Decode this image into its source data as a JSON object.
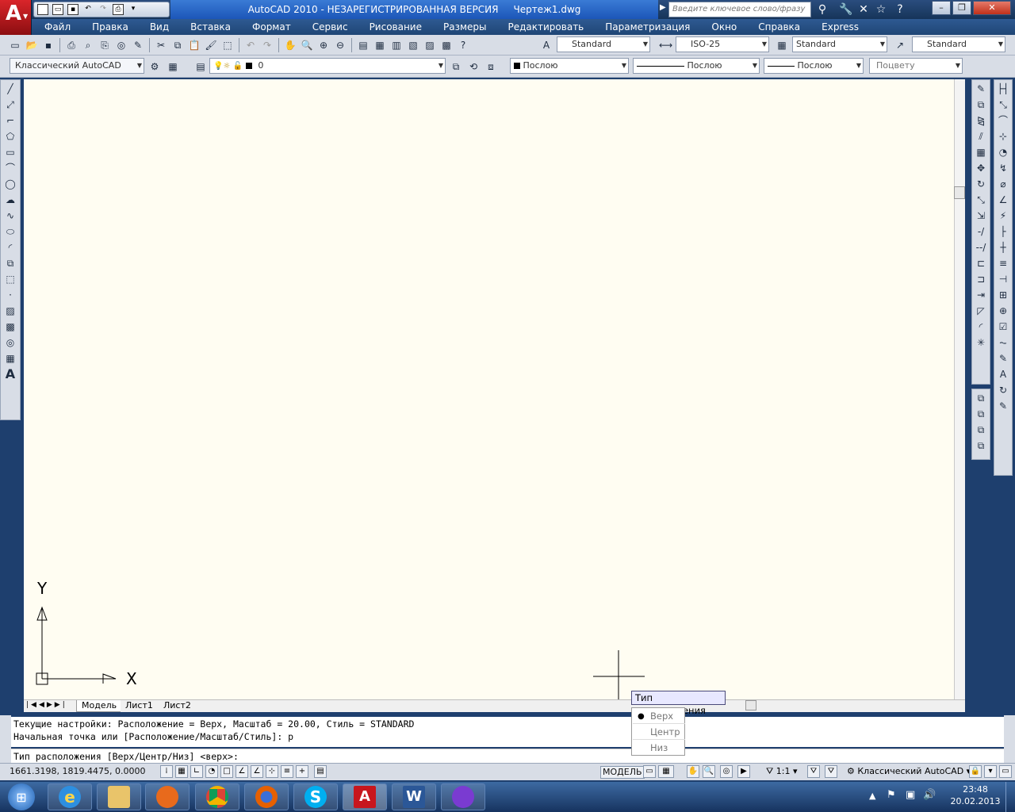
{
  "titlebar": {
    "title": "AutoCAD 2010 - НЕЗАРЕГИСТРИРОВАННАЯ ВЕРСИЯ     Чертеж1.dwg",
    "search_placeholder": "Введите ключевое слово/фразу"
  },
  "menu": [
    "Файл",
    "Правка",
    "Вид",
    "Вставка",
    "Формат",
    "Сервис",
    "Рисование",
    "Размеры",
    "Редактировать",
    "Параметризация",
    "Окно",
    "Справка",
    "Express"
  ],
  "toolbar_styles": {
    "text_style": "Standard",
    "dim_style": "ISO-25",
    "table_style": "Standard",
    "multileader_style": "Standard"
  },
  "toolbar_layers": {
    "workspace": "Классический AutoCAD",
    "layer": "0",
    "color": "Послою",
    "linetype": "Послою",
    "lineweight": "Послою",
    "plotstyle": "Поцвету"
  },
  "ucs": {
    "x_label": "X",
    "y_label": "Y"
  },
  "tabs": [
    "Модель",
    "Лист1",
    "Лист2"
  ],
  "command": {
    "history": [
      "Текущие настройки: Расположение = Верх, Масштаб = 20.00, Стиль = STANDARD",
      "Начальная точка или [Расположение/Масштаб/Стиль]:  р"
    ],
    "prompt": "Тип расположения [Верх/Центр/Низ] <верх>:"
  },
  "dynamic_input": {
    "tooltip": "Тип расположения",
    "options": [
      "Верх",
      "Центр",
      "Низ"
    ],
    "selected": "Верх"
  },
  "statusbar": {
    "coords": "1661.3198, 1819.4475, 0.0000",
    "model_label": "МОДЕЛЬ",
    "scale": "1:1",
    "workspace": "Классический AutoCAD"
  },
  "taskbar": {
    "time": "23:48",
    "date": "20.02.2013"
  }
}
